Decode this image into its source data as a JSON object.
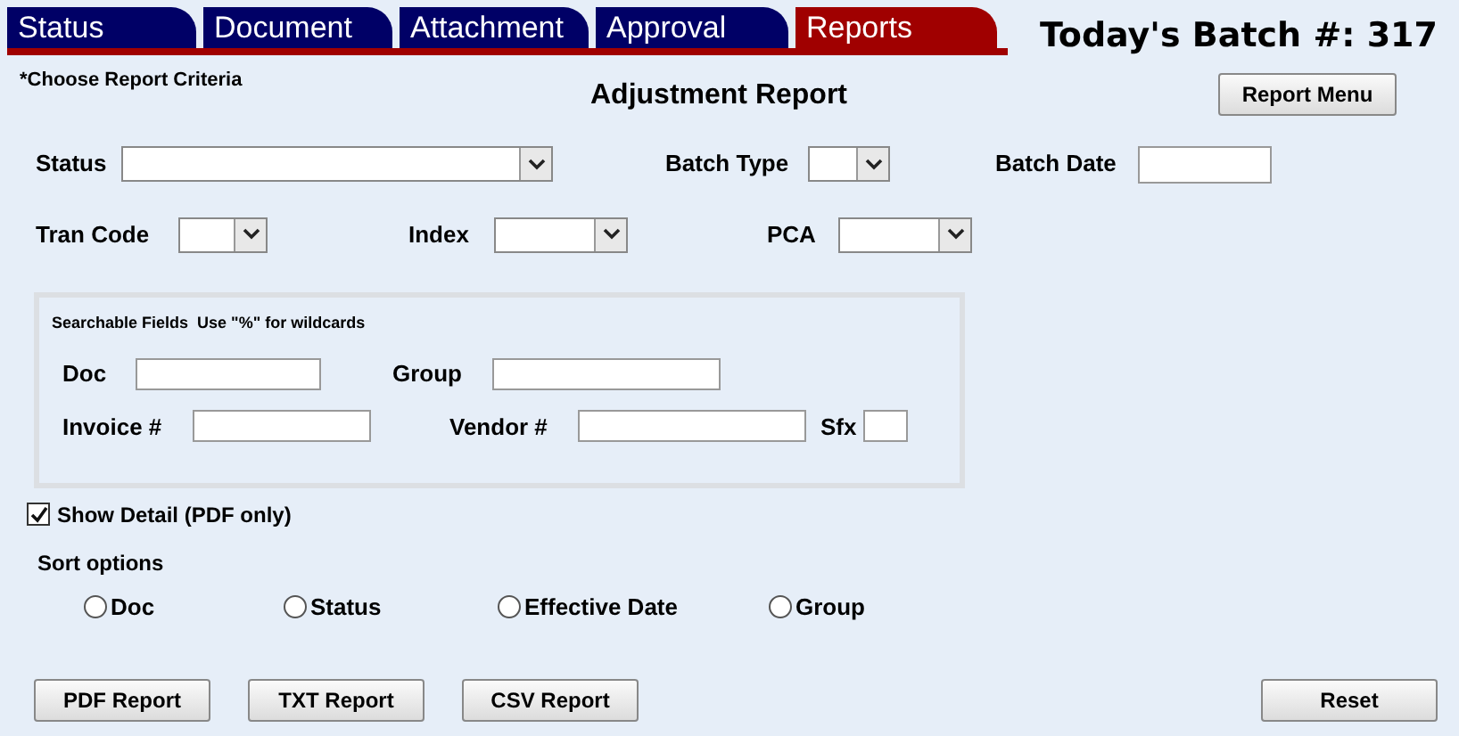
{
  "tabs": [
    {
      "label": "Status",
      "selected": false
    },
    {
      "label": "Document",
      "selected": false
    },
    {
      "label": "Attachment",
      "selected": false
    },
    {
      "label": "Approval",
      "selected": false
    },
    {
      "label": "Reports",
      "selected": true
    }
  ],
  "batch": "Today's Batch #: 317",
  "hint": "*Choose Report Criteria",
  "title": "Adjustment Report",
  "report_menu_button": "Report Menu",
  "criteria_rows": [
    [
      {
        "label": "Status",
        "kind": "dropdown"
      },
      {
        "label": "Batch Type",
        "kind": "dropdown"
      },
      {
        "label": "Batch Date",
        "kind": "input"
      }
    ],
    [
      {
        "label": "Tran Code",
        "kind": "dropdown"
      },
      {
        "label": "Index",
        "kind": "dropdown"
      },
      {
        "label": "PCA",
        "kind": "dropdown"
      }
    ]
  ],
  "searchable": {
    "heading": "Searchable Fields  Use \"%\" for wildcards",
    "rows": [
      [
        {
          "label": "Doc"
        },
        {
          "label": "Group"
        }
      ],
      [
        {
          "label": "Invoice #"
        },
        {
          "label": "Vendor #"
        },
        {
          "label": "Sfx"
        }
      ]
    ]
  },
  "show_detail": {
    "label": "Show Detail (PDF only)",
    "checked": true
  },
  "sort": {
    "heading": "Sort options",
    "options": [
      {
        "label": "Doc",
        "selected": false
      },
      {
        "label": "Status",
        "selected": false
      },
      {
        "label": "Effective Date",
        "selected": false
      },
      {
        "label": "Group",
        "selected": false
      }
    ]
  },
  "report_buttons": [
    "PDF Report",
    "TXT Report",
    "CSV Report"
  ],
  "reset_button": "Reset"
}
